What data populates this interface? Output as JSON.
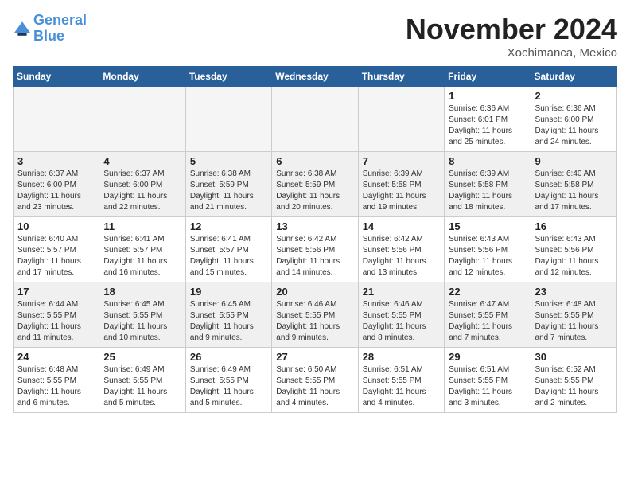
{
  "logo": {
    "line1": "General",
    "line2": "Blue"
  },
  "title": "November 2024",
  "location": "Xochimanca, Mexico",
  "weekdays": [
    "Sunday",
    "Monday",
    "Tuesday",
    "Wednesday",
    "Thursday",
    "Friday",
    "Saturday"
  ],
  "weeks": [
    [
      {
        "day": "",
        "info": "",
        "empty": true
      },
      {
        "day": "",
        "info": "",
        "empty": true
      },
      {
        "day": "",
        "info": "",
        "empty": true
      },
      {
        "day": "",
        "info": "",
        "empty": true
      },
      {
        "day": "",
        "info": "",
        "empty": true
      },
      {
        "day": "1",
        "info": "Sunrise: 6:36 AM\nSunset: 6:01 PM\nDaylight: 11 hours\nand 25 minutes.",
        "empty": false
      },
      {
        "day": "2",
        "info": "Sunrise: 6:36 AM\nSunset: 6:00 PM\nDaylight: 11 hours\nand 24 minutes.",
        "empty": false
      }
    ],
    [
      {
        "day": "3",
        "info": "Sunrise: 6:37 AM\nSunset: 6:00 PM\nDaylight: 11 hours\nand 23 minutes.",
        "empty": false
      },
      {
        "day": "4",
        "info": "Sunrise: 6:37 AM\nSunset: 6:00 PM\nDaylight: 11 hours\nand 22 minutes.",
        "empty": false
      },
      {
        "day": "5",
        "info": "Sunrise: 6:38 AM\nSunset: 5:59 PM\nDaylight: 11 hours\nand 21 minutes.",
        "empty": false
      },
      {
        "day": "6",
        "info": "Sunrise: 6:38 AM\nSunset: 5:59 PM\nDaylight: 11 hours\nand 20 minutes.",
        "empty": false
      },
      {
        "day": "7",
        "info": "Sunrise: 6:39 AM\nSunset: 5:58 PM\nDaylight: 11 hours\nand 19 minutes.",
        "empty": false
      },
      {
        "day": "8",
        "info": "Sunrise: 6:39 AM\nSunset: 5:58 PM\nDaylight: 11 hours\nand 18 minutes.",
        "empty": false
      },
      {
        "day": "9",
        "info": "Sunrise: 6:40 AM\nSunset: 5:58 PM\nDaylight: 11 hours\nand 17 minutes.",
        "empty": false
      }
    ],
    [
      {
        "day": "10",
        "info": "Sunrise: 6:40 AM\nSunset: 5:57 PM\nDaylight: 11 hours\nand 17 minutes.",
        "empty": false
      },
      {
        "day": "11",
        "info": "Sunrise: 6:41 AM\nSunset: 5:57 PM\nDaylight: 11 hours\nand 16 minutes.",
        "empty": false
      },
      {
        "day": "12",
        "info": "Sunrise: 6:41 AM\nSunset: 5:57 PM\nDaylight: 11 hours\nand 15 minutes.",
        "empty": false
      },
      {
        "day": "13",
        "info": "Sunrise: 6:42 AM\nSunset: 5:56 PM\nDaylight: 11 hours\nand 14 minutes.",
        "empty": false
      },
      {
        "day": "14",
        "info": "Sunrise: 6:42 AM\nSunset: 5:56 PM\nDaylight: 11 hours\nand 13 minutes.",
        "empty": false
      },
      {
        "day": "15",
        "info": "Sunrise: 6:43 AM\nSunset: 5:56 PM\nDaylight: 11 hours\nand 12 minutes.",
        "empty": false
      },
      {
        "day": "16",
        "info": "Sunrise: 6:43 AM\nSunset: 5:56 PM\nDaylight: 11 hours\nand 12 minutes.",
        "empty": false
      }
    ],
    [
      {
        "day": "17",
        "info": "Sunrise: 6:44 AM\nSunset: 5:55 PM\nDaylight: 11 hours\nand 11 minutes.",
        "empty": false
      },
      {
        "day": "18",
        "info": "Sunrise: 6:45 AM\nSunset: 5:55 PM\nDaylight: 11 hours\nand 10 minutes.",
        "empty": false
      },
      {
        "day": "19",
        "info": "Sunrise: 6:45 AM\nSunset: 5:55 PM\nDaylight: 11 hours\nand 9 minutes.",
        "empty": false
      },
      {
        "day": "20",
        "info": "Sunrise: 6:46 AM\nSunset: 5:55 PM\nDaylight: 11 hours\nand 9 minutes.",
        "empty": false
      },
      {
        "day": "21",
        "info": "Sunrise: 6:46 AM\nSunset: 5:55 PM\nDaylight: 11 hours\nand 8 minutes.",
        "empty": false
      },
      {
        "day": "22",
        "info": "Sunrise: 6:47 AM\nSunset: 5:55 PM\nDaylight: 11 hours\nand 7 minutes.",
        "empty": false
      },
      {
        "day": "23",
        "info": "Sunrise: 6:48 AM\nSunset: 5:55 PM\nDaylight: 11 hours\nand 7 minutes.",
        "empty": false
      }
    ],
    [
      {
        "day": "24",
        "info": "Sunrise: 6:48 AM\nSunset: 5:55 PM\nDaylight: 11 hours\nand 6 minutes.",
        "empty": false
      },
      {
        "day": "25",
        "info": "Sunrise: 6:49 AM\nSunset: 5:55 PM\nDaylight: 11 hours\nand 5 minutes.",
        "empty": false
      },
      {
        "day": "26",
        "info": "Sunrise: 6:49 AM\nSunset: 5:55 PM\nDaylight: 11 hours\nand 5 minutes.",
        "empty": false
      },
      {
        "day": "27",
        "info": "Sunrise: 6:50 AM\nSunset: 5:55 PM\nDaylight: 11 hours\nand 4 minutes.",
        "empty": false
      },
      {
        "day": "28",
        "info": "Sunrise: 6:51 AM\nSunset: 5:55 PM\nDaylight: 11 hours\nand 4 minutes.",
        "empty": false
      },
      {
        "day": "29",
        "info": "Sunrise: 6:51 AM\nSunset: 5:55 PM\nDaylight: 11 hours\nand 3 minutes.",
        "empty": false
      },
      {
        "day": "30",
        "info": "Sunrise: 6:52 AM\nSunset: 5:55 PM\nDaylight: 11 hours\nand 2 minutes.",
        "empty": false
      }
    ]
  ]
}
